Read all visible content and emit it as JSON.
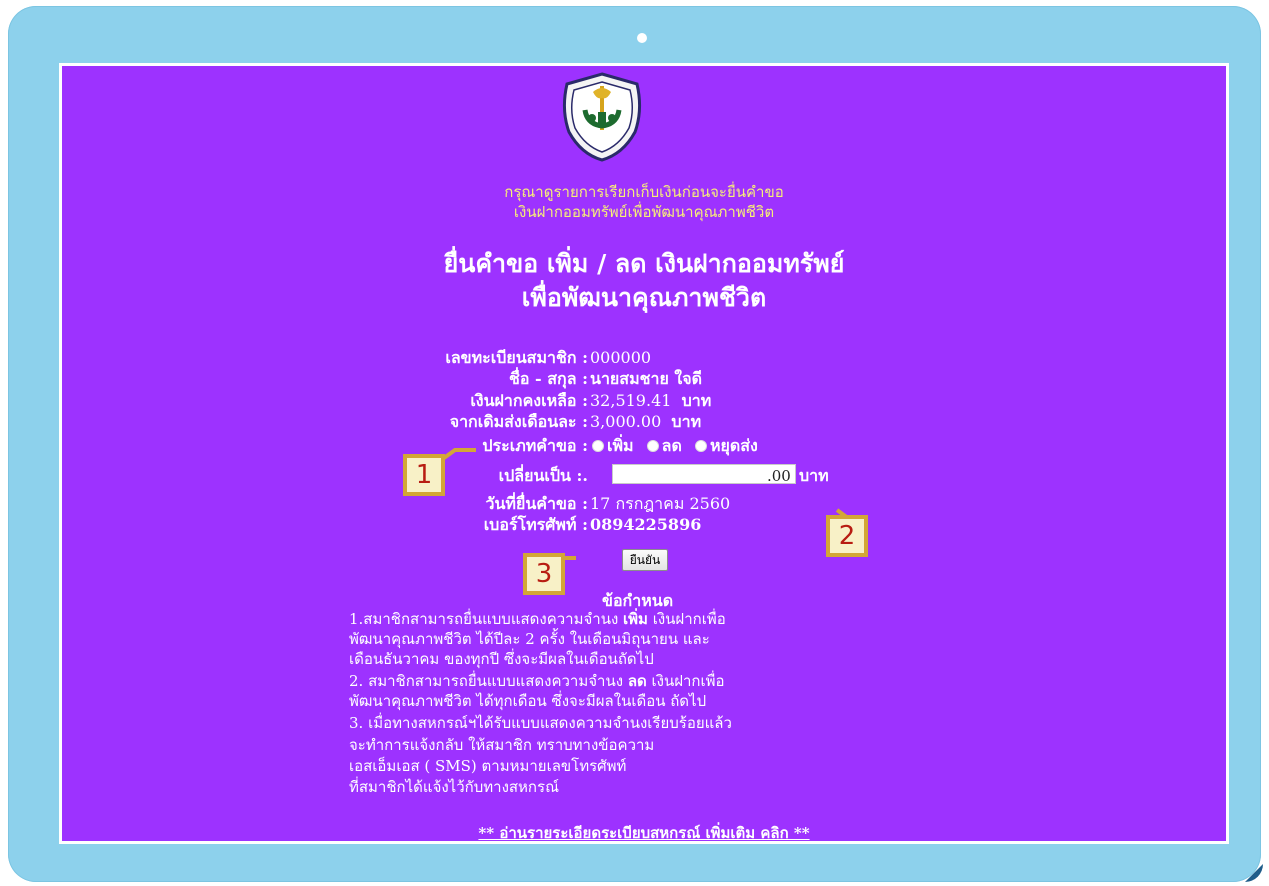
{
  "logo_alt": "สหกรณ์ออมทรัพย์ครูราชบุรี",
  "intro": {
    "line1": "กรุณาดูรายการเรียกเก็บเงินก่อนจะยื่นคำขอ",
    "line2": "เงินฝากออมทรัพย์เพื่อพัฒนาคุณภาพชีวิต"
  },
  "heading": {
    "line1": "ยื่นคำขอ เพิ่ม / ลด เงินฝากออมทรัพย์",
    "line2": "เพื่อพัฒนาคุณภาพชีวิต"
  },
  "fields": {
    "member_no_label": "เลขทะเบียนสมาชิก :",
    "member_no": "000000",
    "name_label": "ชื่อ - สกุล :",
    "name": "นายสมชาย ใจดี",
    "balance_label": "เงินฝากคงเหลือ :",
    "balance": "32,519.41",
    "balance_unit": "บาท",
    "monthly_label": "จากเดิมส่งเดือนละ :",
    "monthly": "3,000.00",
    "monthly_unit": "บาท",
    "request_type_label": "ประเภทคำขอ :",
    "request_options": [
      "เพิ่ม",
      "ลด",
      "หยุดส่ง"
    ],
    "change_to_label": "เปลี่ยนเป็น :.",
    "change_to_value": "",
    "change_to_suffix": ".00",
    "change_to_unit": "บาท",
    "date_label": "วันที่ยื่นคำขอ :",
    "date": "17 กรกฎาคม 2560",
    "phone_label": "เบอร์โทรศัพท์ :",
    "phone": "0894225896"
  },
  "submit_label": "ยืนยัน",
  "rules": {
    "title": "ข้อกำหนด",
    "lines": [
      [
        "1.สมาชิกสามารถยื่นแบบแสดงความจำนง ",
        "เพิ่ม",
        " เงินฝากเพื่อ"
      ],
      [
        "พัฒนาคุณภาพชีวิต ได้ปีละ 2 ครั้ง ในเดือนมิถุนายน และ",
        "",
        ""
      ],
      [
        "เดือนธันวาคม ของทุกปี ซึ่งจะมีผลในเดือนถัดไป",
        "",
        ""
      ],
      [
        "2. สมาชิกสามารถยื่นแบบแสดงความจำนง ",
        "ลด",
        " เงินฝากเพื่อ"
      ],
      [
        "พัฒนาคุณภาพชีวิต ได้ทุกเดือน ซึ่งจะมีผลในเดือน ถัดไป",
        "",
        ""
      ],
      [
        "3. เมื่อทางสหกรณ์ฯได้รับแบบแสดงความจำนงเรียบร้อยแล้ว",
        "",
        ""
      ],
      [
        "จะทำการแจ้งกลับ ให้สมาชิก ทราบทางข้อความ",
        "",
        ""
      ],
      [
        "เอสเอ็มเอส ( SMS) ตามหมายเลขโทรศัพท์",
        "",
        ""
      ],
      [
        "ที่สมาชิกได้แจ้งไว้กับทางสหกรณ์",
        "",
        ""
      ]
    ]
  },
  "footer_link": "** อ่านรายระเอียดระเบียบสหกรณ์ เพิ่มเติม คลิก **",
  "callouts": [
    "1",
    "2",
    "3"
  ],
  "colors": {
    "frame": "#8dd1ec",
    "page_bg": "#9d32ff",
    "intro_text": "#f7ef78",
    "callout_border": "#d3a636",
    "callout_text": "#b81d12"
  }
}
